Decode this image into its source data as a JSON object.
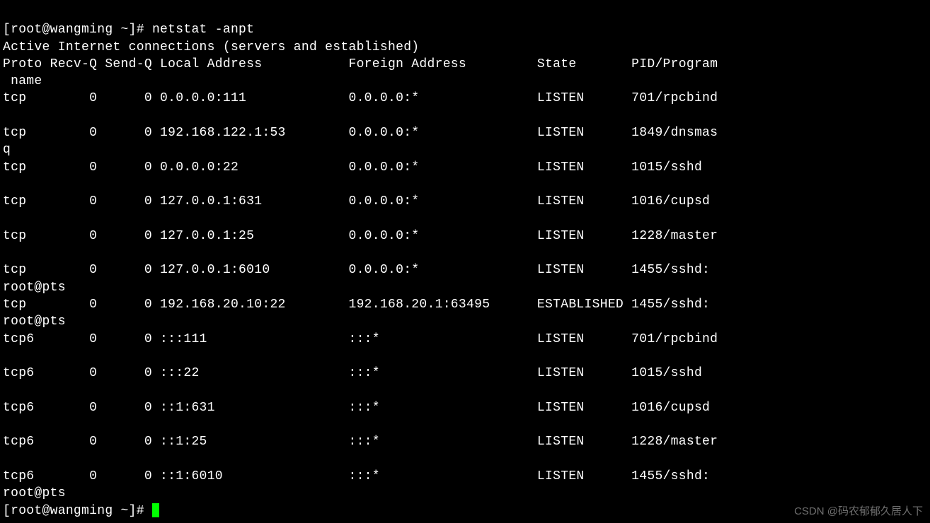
{
  "prompt1": "[root@wangming ~]# ",
  "command": "netstat -anpt",
  "header1": "Active Internet connections (servers and established)",
  "cols": "Proto Recv-Q Send-Q Local Address           Foreign Address         State       PID/Program\n name",
  "rows": [
    "tcp        0      0 0.0.0.0:111             0.0.0.0:*               LISTEN      701/rpcbind\n",
    "tcp        0      0 192.168.122.1:53        0.0.0.0:*               LISTEN      1849/dnsmas\nq",
    "tcp        0      0 0.0.0.0:22              0.0.0.0:*               LISTEN      1015/sshd\n",
    "tcp        0      0 127.0.0.1:631           0.0.0.0:*               LISTEN      1016/cupsd\n",
    "tcp        0      0 127.0.0.1:25            0.0.0.0:*               LISTEN      1228/master\n",
    "tcp        0      0 127.0.0.1:6010          0.0.0.0:*               LISTEN      1455/sshd:\nroot@pts",
    "tcp        0      0 192.168.20.10:22        192.168.20.1:63495      ESTABLISHED 1455/sshd:\nroot@pts",
    "tcp6       0      0 :::111                  :::*                    LISTEN      701/rpcbind\n",
    "tcp6       0      0 :::22                   :::*                    LISTEN      1015/sshd\n",
    "tcp6       0      0 ::1:631                 :::*                    LISTEN      1016/cupsd\n",
    "tcp6       0      0 ::1:25                  :::*                    LISTEN      1228/master\n",
    "tcp6       0      0 ::1:6010                :::*                    LISTEN      1455/sshd:\nroot@pts"
  ],
  "prompt2": "[root@wangming ~]# ",
  "watermark": "CSDN @码农郁郁久居人下"
}
